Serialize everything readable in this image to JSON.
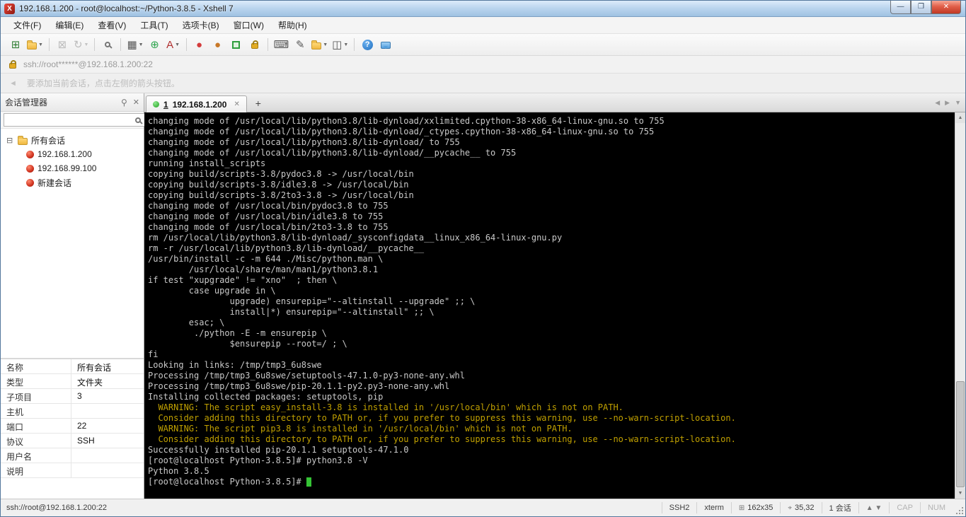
{
  "window": {
    "title": "192.168.1.200 - root@localhost:~/Python-3.8.5 - Xshell 7"
  },
  "menu_bar": {
    "items": [
      {
        "name": "menu-file",
        "label": "文件(F)"
      },
      {
        "name": "menu-edit",
        "label": "编辑(E)"
      },
      {
        "name": "menu-view",
        "label": "查看(V)"
      },
      {
        "name": "menu-tools",
        "label": "工具(T)"
      },
      {
        "name": "menu-tabs",
        "label": "选项卡(B)"
      },
      {
        "name": "menu-window",
        "label": "窗口(W)"
      },
      {
        "name": "menu-help",
        "label": "帮助(H)"
      }
    ]
  },
  "toolbar": {
    "buttons": [
      {
        "name": "new-session-button",
        "icon": "new-session-icon",
        "glyph": "⊞",
        "color": "#2e7d32"
      },
      {
        "name": "open-sessions-button",
        "icon": "folder-open-icon",
        "cls": "folder-ic",
        "dropdown": true
      },
      {
        "sep": true
      },
      {
        "name": "disconnect-button",
        "icon": "disconnect-icon",
        "glyph": "⊠",
        "disabled": true
      },
      {
        "name": "reconnect-button",
        "icon": "reconnect-icon",
        "glyph": "↻",
        "disabled": true,
        "dropdown": true
      },
      {
        "sep": true
      },
      {
        "name": "find-button",
        "icon": "search-icon",
        "cls": "search-ic"
      },
      {
        "sep": true
      },
      {
        "name": "new-terminal-button",
        "icon": "terminal-icon",
        "glyph": "▦",
        "dropdown": true
      },
      {
        "name": "web-browser-button",
        "icon": "globe-icon",
        "glyph": "⊕",
        "color": "#2fa44f"
      },
      {
        "name": "appearance-button",
        "icon": "font-color-icon",
        "glyph": "A",
        "color": "#b03030",
        "dropdown": true
      },
      {
        "sep": true
      },
      {
        "name": "xagent-button",
        "icon": "red-ball-icon",
        "glyph": "●",
        "color": "#d43c3c"
      },
      {
        "name": "xftp-button",
        "icon": "orange-ball-icon",
        "glyph": "●",
        "color": "#c87828"
      },
      {
        "name": "fullscreen-button",
        "icon": "fullscreen-icon",
        "cls": "fs-ic"
      },
      {
        "name": "lock-screen-button",
        "icon": "lock-icon",
        "cls": "lock-ic"
      },
      {
        "sep": true
      },
      {
        "name": "keypad-button",
        "icon": "keypad-icon",
        "glyph": "⌨"
      },
      {
        "name": "compose-button",
        "icon": "pen-icon",
        "glyph": "✎"
      },
      {
        "name": "file-transfer-button",
        "icon": "transfer-folder-icon",
        "cls": "folder-ic",
        "dropdown": true
      },
      {
        "name": "arrange-windows-button",
        "icon": "tile-windows-icon",
        "glyph": "◫",
        "dropdown": true
      },
      {
        "sep": true
      },
      {
        "name": "help-button",
        "icon": "help-icon",
        "glyph": "?",
        "cls": "help-ic"
      },
      {
        "name": "feedback-button",
        "icon": "chat-bubble-icon",
        "cls": "chat-ic"
      }
    ]
  },
  "address_bar": {
    "value": "ssh://root******@192.168.1.200:22"
  },
  "info_bar": {
    "text": "要添加当前会话，点击左侧的箭头按钮。"
  },
  "sidebar": {
    "title": "会话管理器",
    "search_value": "",
    "tree": {
      "root_label": "所有会话",
      "sessions": [
        {
          "label": "192.168.1.200"
        },
        {
          "label": "192.168.99.100"
        },
        {
          "label": "新建会话"
        }
      ]
    },
    "properties": [
      {
        "key": "名称",
        "value": "所有会话"
      },
      {
        "key": "类型",
        "value": "文件夹"
      },
      {
        "key": "子项目",
        "value": "3"
      },
      {
        "key": "主机",
        "value": ""
      },
      {
        "key": "端口",
        "value": "22"
      },
      {
        "key": "协议",
        "value": "SSH"
      },
      {
        "key": "用户名",
        "value": ""
      },
      {
        "key": "说明",
        "value": ""
      }
    ]
  },
  "tab_bar": {
    "active_tab": {
      "number": "1",
      "label": "192.168.1.200"
    },
    "new_tab_label": "+"
  },
  "terminal": {
    "cursor_color": "#35c435",
    "lines": [
      {
        "text": "changing mode of /usr/local/lib/python3.8/lib-dynload/xxlimited.cpython-38-x86_64-linux-gnu.so to 755"
      },
      {
        "text": "changing mode of /usr/local/lib/python3.8/lib-dynload/_ctypes.cpython-38-x86_64-linux-gnu.so to 755"
      },
      {
        "text": "changing mode of /usr/local/lib/python3.8/lib-dynload/ to 755"
      },
      {
        "text": "changing mode of /usr/local/lib/python3.8/lib-dynload/__pycache__ to 755"
      },
      {
        "text": "running install_scripts"
      },
      {
        "text": "copying build/scripts-3.8/pydoc3.8 -> /usr/local/bin"
      },
      {
        "text": "copying build/scripts-3.8/idle3.8 -> /usr/local/bin"
      },
      {
        "text": "copying build/scripts-3.8/2to3-3.8 -> /usr/local/bin"
      },
      {
        "text": "changing mode of /usr/local/bin/pydoc3.8 to 755"
      },
      {
        "text": "changing mode of /usr/local/bin/idle3.8 to 755"
      },
      {
        "text": "changing mode of /usr/local/bin/2to3-3.8 to 755"
      },
      {
        "text": "rm /usr/local/lib/python3.8/lib-dynload/_sysconfigdata__linux_x86_64-linux-gnu.py"
      },
      {
        "text": "rm -r /usr/local/lib/python3.8/lib-dynload/__pycache__"
      },
      {
        "text": "/usr/bin/install -c -m 644 ./Misc/python.man \\"
      },
      {
        "text": "        /usr/local/share/man/man1/python3.8.1"
      },
      {
        "text": "if test \"xupgrade\" != \"xno\"  ; then \\"
      },
      {
        "text": "        case upgrade in \\"
      },
      {
        "text": "                upgrade) ensurepip=\"--altinstall --upgrade\" ;; \\"
      },
      {
        "text": "                install|*) ensurepip=\"--altinstall\" ;; \\"
      },
      {
        "text": "        esac; \\"
      },
      {
        "text": "         ./python -E -m ensurepip \\"
      },
      {
        "text": "                $ensurepip --root=/ ; \\"
      },
      {
        "text": "fi"
      },
      {
        "text": "Looking in links: /tmp/tmp3_6u8swe"
      },
      {
        "text": "Processing /tmp/tmp3_6u8swe/setuptools-47.1.0-py3-none-any.whl"
      },
      {
        "text": "Processing /tmp/tmp3_6u8swe/pip-20.1.1-py2.py3-none-any.whl"
      },
      {
        "text": "Installing collected packages: setuptools, pip"
      },
      {
        "text": "  WARNING: The script easy_install-3.8 is installed in '/usr/local/bin' which is not on PATH.",
        "warning": true
      },
      {
        "text": "  Consider adding this directory to PATH or, if you prefer to suppress this warning, use --no-warn-script-location.",
        "warning": true
      },
      {
        "text": "  WARNING: The script pip3.8 is installed in '/usr/local/bin' which is not on PATH.",
        "warning": true
      },
      {
        "text": "  Consider adding this directory to PATH or, if you prefer to suppress this warning, use --no-warn-script-location.",
        "warning": true
      },
      {
        "text": "Successfully installed pip-20.1.1 setuptools-47.1.0"
      },
      {
        "text": "[root@localhost Python-3.8.5]# python3.8 -V"
      },
      {
        "text": "Python 3.8.5"
      },
      {
        "text": "[root@localhost Python-3.8.5]# ",
        "cursor": true
      }
    ]
  },
  "status_bar": {
    "connection": "ssh://root@192.168.1.200:22",
    "items": [
      {
        "name": "status-protocol",
        "text": "SSH2"
      },
      {
        "name": "status-terminal-type",
        "text": "xterm"
      },
      {
        "name": "status-terminal-size",
        "glyph": "⊞",
        "glyph_name": "grid-size-icon",
        "text": "162x35"
      },
      {
        "name": "status-cursor-position",
        "glyph": "⌖",
        "glyph_name": "cursor-position-icon",
        "text": "35,32"
      },
      {
        "name": "status-session-count",
        "text": "1 会话"
      },
      {
        "name": "status-session-nav",
        "glyph": "▲ ▼",
        "glyph_name": "session-nav-icons",
        "text": "",
        "interactable": true
      },
      {
        "name": "status-caps-lock",
        "text": "CAP",
        "dim": true
      },
      {
        "name": "status-num-lock",
        "text": "NUM",
        "dim": true
      }
    ]
  }
}
